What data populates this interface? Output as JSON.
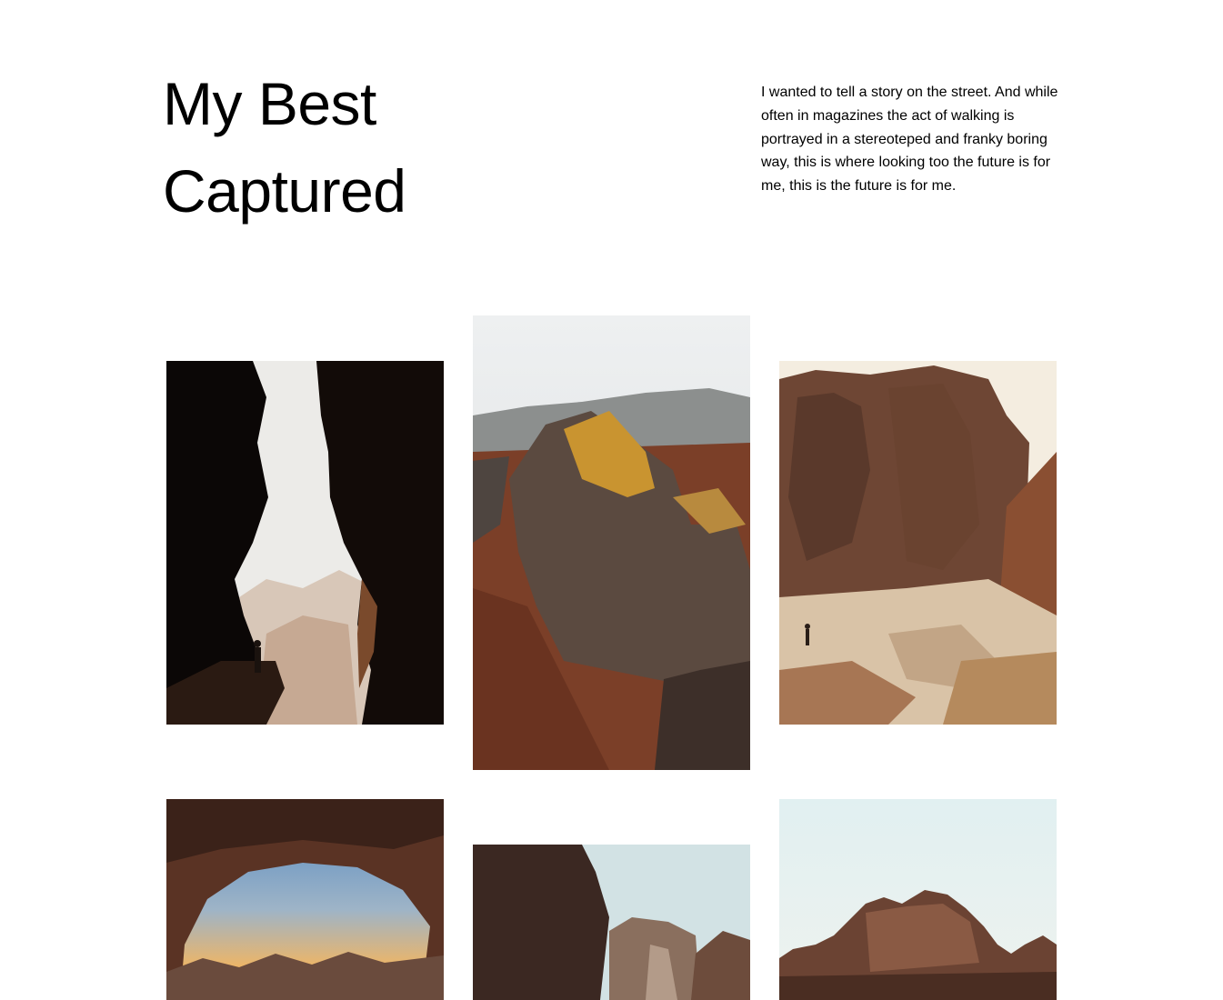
{
  "header": {
    "title_line1": "My Best",
    "title_line2": "Captured",
    "intro": "I wanted to tell a story on the street. And while often in magazines the act of walking is portrayed in a stereoteped and franky boring way, this is where looking too the future is for me, this is the future is for me."
  },
  "gallery": {
    "photos": [
      {
        "subject": "cave-silhouette"
      },
      {
        "subject": "aerial-rock-formation"
      },
      {
        "subject": "canyon-walker"
      },
      {
        "subject": "rock-arch-sunset"
      },
      {
        "subject": "canyon-cliffs"
      },
      {
        "subject": "rock-mesa"
      }
    ]
  }
}
